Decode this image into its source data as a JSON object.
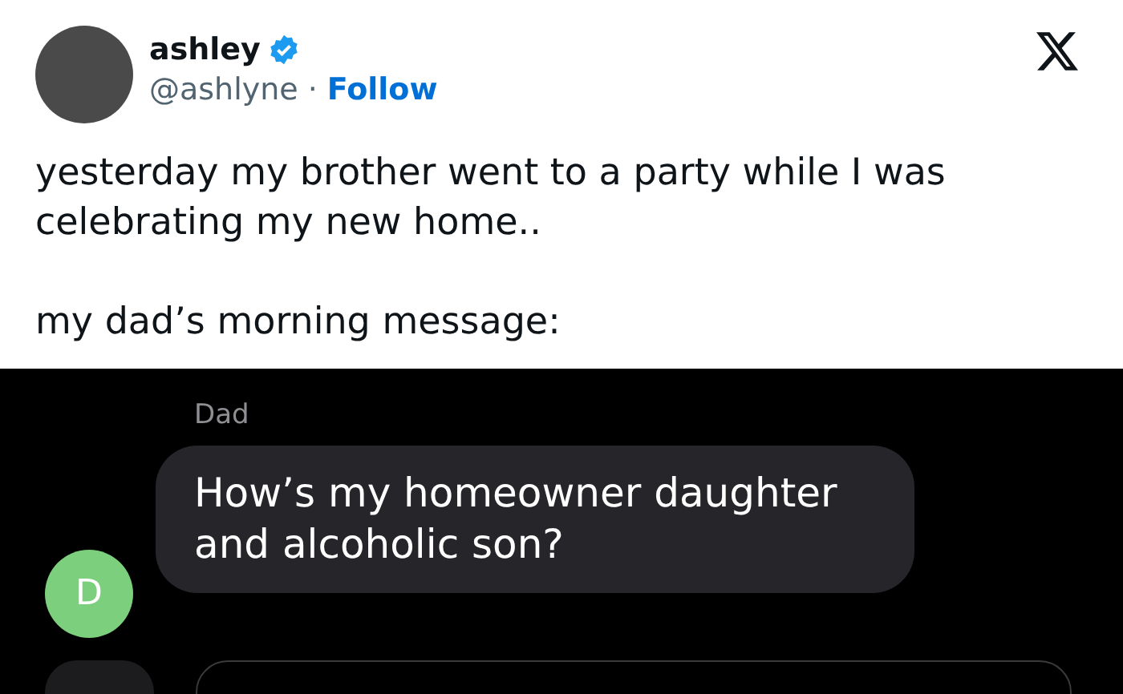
{
  "tweet": {
    "author": {
      "name": "ashley",
      "handle": "@ashlyne",
      "verified": true
    },
    "separator": "·",
    "follow_label": "Follow",
    "paragraphs": [
      "yesterday my brother went to a party while I was celebrating my new home..",
      "my dad’s morning message:"
    ]
  },
  "screenshot": {
    "sender_label": "Dad",
    "message": "How’s my homeowner daughter and alcoholic son?",
    "avatar_initial": "D"
  }
}
